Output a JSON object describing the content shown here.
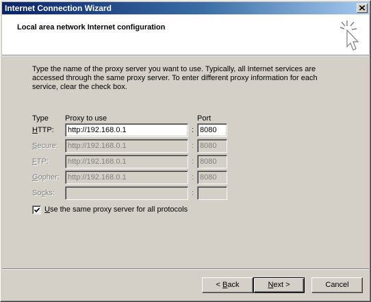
{
  "window": {
    "title": "Internet Connection Wizard",
    "close_icon": "close-icon"
  },
  "header": {
    "heading": "Local area network Internet configuration",
    "icon": "wizard-cursor-icon"
  },
  "description": "Type the name of the proxy server you want to use. Typically, all Internet services are accessed through the same proxy server. To enter different proxy information for each service, clear the check box.",
  "columns": {
    "type": "Type",
    "proxy": "Proxy to use",
    "port": "Port"
  },
  "rows": [
    {
      "pre": "",
      "key": "H",
      "post": "TTP:",
      "proxy": "http://192.168.0.1",
      "port": "8080",
      "enabled": true
    },
    {
      "pre": "",
      "key": "S",
      "post": "ecure:",
      "proxy": "http://192.168.0.1",
      "port": "8080",
      "enabled": false
    },
    {
      "pre": "",
      "key": "F",
      "post": "TP:",
      "proxy": "http://192.168.0.1",
      "port": "8080",
      "enabled": false
    },
    {
      "pre": "",
      "key": "G",
      "post": "opher:",
      "proxy": "http://192.168.0.1",
      "port": "8080",
      "enabled": false
    },
    {
      "pre": "So",
      "key": "c",
      "post": "ks:",
      "proxy": "",
      "port": "",
      "enabled": false
    }
  ],
  "colon": ":",
  "same_proxy": {
    "pre": "",
    "key": "U",
    "post": "se the same proxy server for all protocols",
    "checked": true
  },
  "buttons": {
    "back": {
      "pre": "< ",
      "key": "B",
      "post": "ack"
    },
    "next": {
      "pre": "",
      "key": "N",
      "post": "ext >"
    },
    "cancel": {
      "label": "Cancel"
    }
  }
}
